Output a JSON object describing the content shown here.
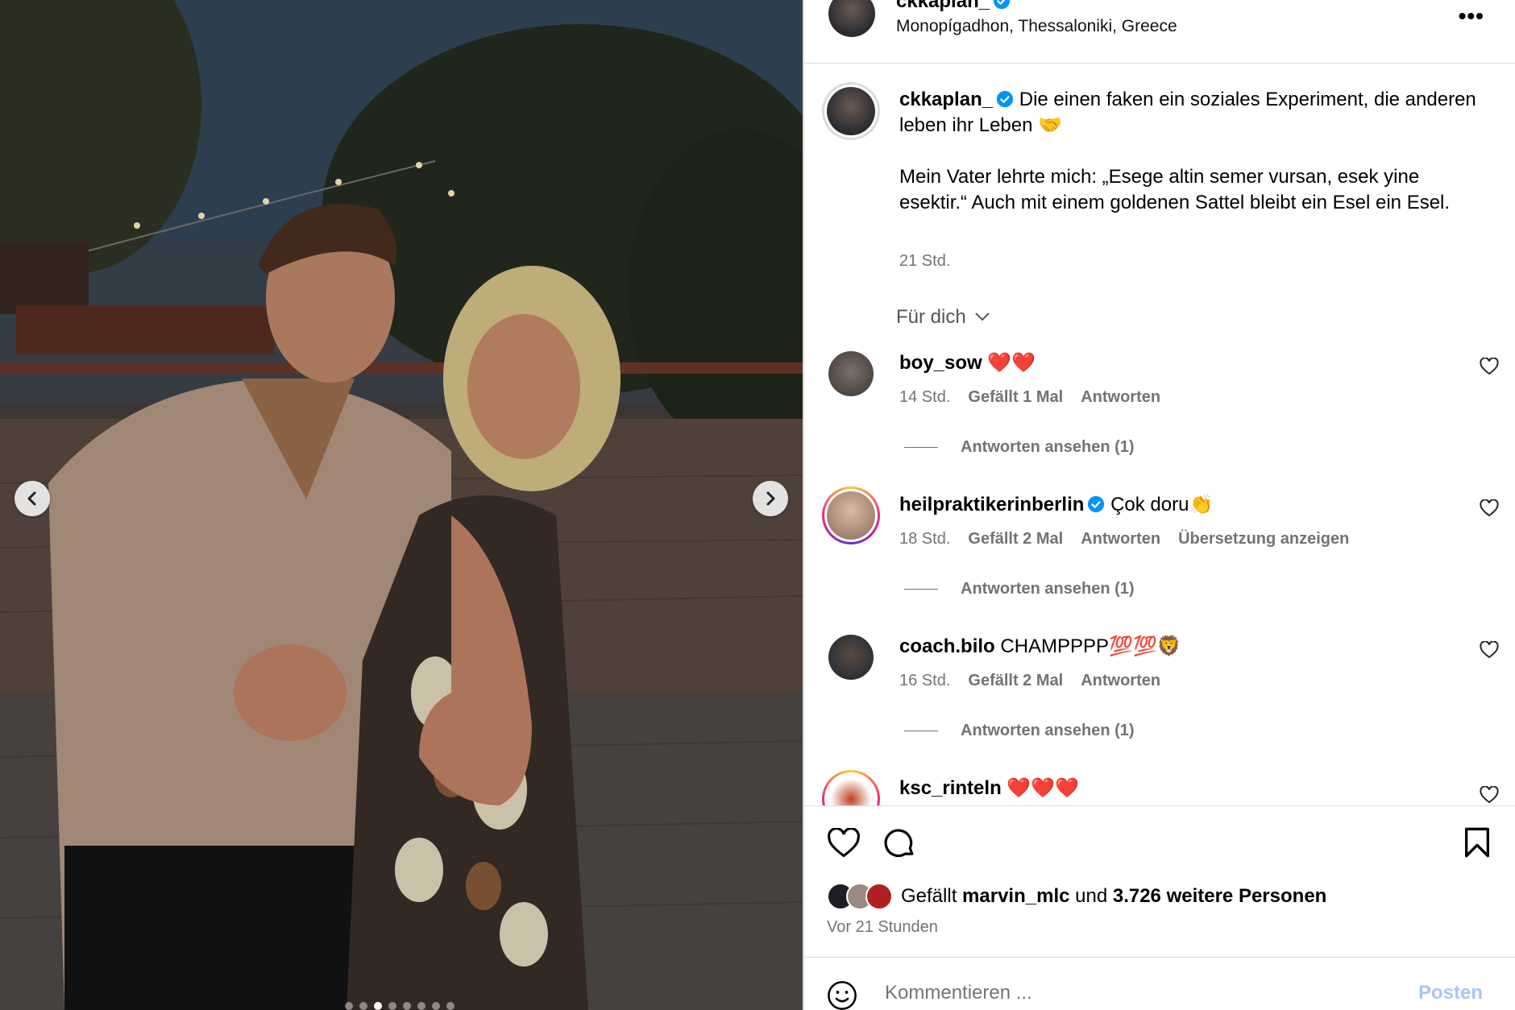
{
  "post": {
    "username": "ckkaplan_",
    "location": "Monopígadhon, Thessaloniki, Greece",
    "caption_line1": "Die einen faken ein soziales Experiment, die anderen leben ihr Leben 🤝",
    "caption_line2": "Mein Vater lehrte mich: „Esege altin semer vursan, esek yine esektir.“ Auch mit einem goldenen Sattel bleibt ein Esel ein Esel.",
    "caption_time": "21 Std.",
    "more_label": "•••"
  },
  "filter_label": "Für dich",
  "comments": [
    {
      "user": "boy_sow",
      "text": "❤️❤️",
      "time": "14 Std.",
      "likes": "Gefällt 1 Mal",
      "reply": "Antworten",
      "translate": "",
      "view_replies": "Antworten ansehen (1)"
    },
    {
      "user": "heilpraktikerinberlin",
      "text": "Çok doru👏",
      "time": "18 Std.",
      "likes": "Gefällt 2 Mal",
      "reply": "Antworten",
      "translate": "Übersetzung anzeigen",
      "view_replies": "Antworten ansehen (1)"
    },
    {
      "user": "coach.bilo",
      "text": "CHAMPPPP💯💯🦁",
      "time": "16 Std.",
      "likes": "Gefällt 2 Mal",
      "reply": "Antworten",
      "translate": "",
      "view_replies": "Antworten ansehen (1)"
    },
    {
      "user": "ksc_rinteln",
      "text": "❤️❤️❤️"
    }
  ],
  "likes": {
    "prefix": "Gefällt",
    "liker": "marvin_mlc",
    "connector": "und",
    "others": "3.726 weitere Personen"
  },
  "posted_ago": "Vor 21 Stunden",
  "comment_input": {
    "placeholder": "Kommentieren ...",
    "post_label": "Posten"
  },
  "carousel": {
    "count": 8,
    "active": 2
  },
  "colors": {
    "verified": "#0095f6",
    "link": "#a7c7f2",
    "secondary": "#737373"
  }
}
